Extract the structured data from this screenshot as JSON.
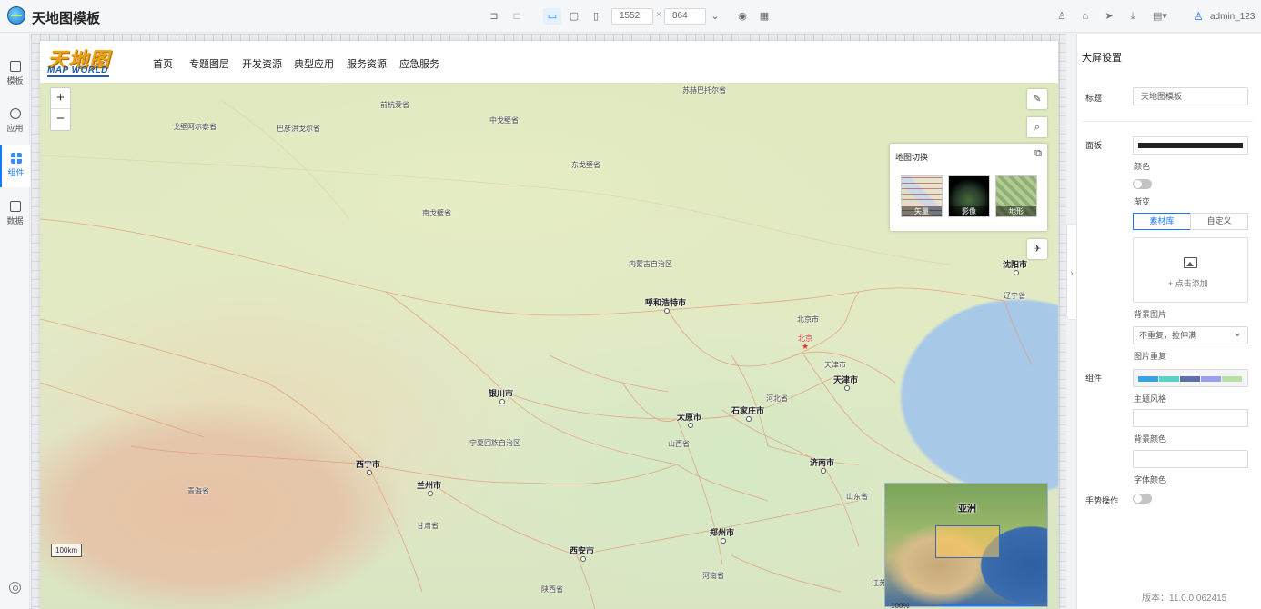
{
  "app": {
    "title": "天地图模板"
  },
  "toolbar": {
    "width": "1552",
    "height": "864",
    "size_sep": "×",
    "user": "admin_123"
  },
  "sidebar": {
    "items": [
      {
        "label": "模板"
      },
      {
        "label": "应用"
      },
      {
        "label": "组件"
      },
      {
        "label": "数据"
      }
    ]
  },
  "map": {
    "logo_cn": "天地图",
    "logo_en": "MAP WORLD",
    "nav": [
      "首页",
      "专题图层",
      "开发资源",
      "典型应用",
      "服务资源",
      "应急服务"
    ],
    "zoom_in": "+",
    "zoom_out": "−",
    "switcher": {
      "title": "地图切换",
      "options": [
        "矢量",
        "影像",
        "地形"
      ]
    },
    "scale": "100km",
    "overview_label": "亚洲",
    "zoom_level": "100%",
    "places": [
      "苏赫巴托尔省",
      "前杭爱省",
      "中戈壁省",
      "戈壁阿尔泰省",
      "巴彦洪戈尔省",
      "东戈壁省",
      "南戈壁省",
      "内蒙古自治区",
      "辽宁省",
      "北京市",
      "河北省",
      "宁夏回族自治区",
      "山西省",
      "青海省",
      "甘肃省",
      "山东省",
      "河南省",
      "陕西省",
      "天津市",
      "江苏"
    ],
    "cities": [
      "沈阳市",
      "呼和浩特市",
      "天津市",
      "银川市",
      "太原市",
      "石家庄市",
      "西宁市",
      "兰州市",
      "济南市",
      "郑州市",
      "西安市"
    ],
    "capital": "北京"
  },
  "panel": {
    "title": "大屏设置",
    "title_label": "标题",
    "title_value": "天地图模板",
    "panel_label": "面板",
    "color_label": "颜色",
    "gradient_label": "渐变",
    "tab_library": "素材库",
    "tab_custom": "自定义",
    "upload_text": "+ 点击添加",
    "bg_image_label": "背景图片",
    "repeat_value": "不重复，拉伸满",
    "repeat_label": "图片重复",
    "component_label": "组件",
    "theme_label": "主题风格",
    "bg_color_label": "背景颜色",
    "font_color_label": "字体颜色",
    "gesture_label": "手势操作",
    "version": "版本：11.0.0.062415",
    "palette": [
      "#3aa2e0",
      "#5ecfc4",
      "#5b6fa8",
      "#9aa0e8",
      "#b7e0a6"
    ]
  }
}
